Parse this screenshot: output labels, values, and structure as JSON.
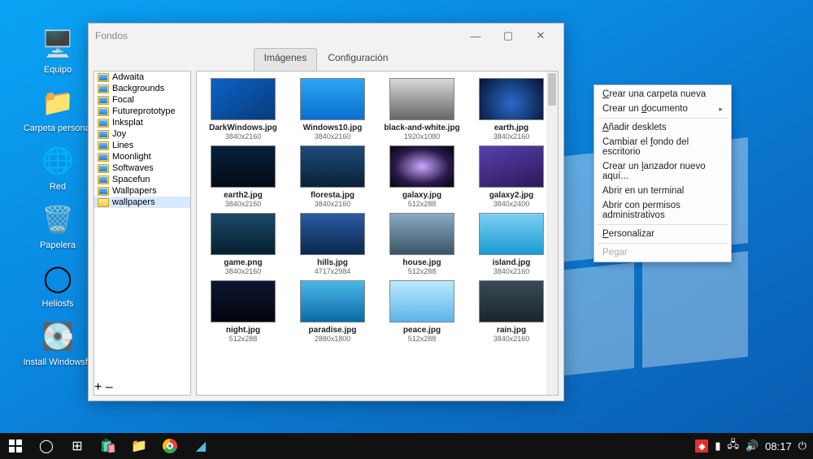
{
  "desktop_icons": [
    {
      "label": "Equipo",
      "glyph": "🖥️"
    },
    {
      "label": "Carpeta personal",
      "glyph": "📁"
    },
    {
      "label": "Red",
      "glyph": "🌐"
    },
    {
      "label": "Papelera",
      "glyph": "🗑️"
    },
    {
      "label": "Heliosfs",
      "glyph": "◯"
    },
    {
      "label": "Install Windowsfs",
      "glyph": "💽"
    }
  ],
  "window": {
    "title": "Fondos",
    "tabs": [
      {
        "label": "Imágenes",
        "active": true
      },
      {
        "label": "Configuración",
        "active": false
      }
    ],
    "folders": [
      {
        "name": "Adwaita",
        "type": "pic"
      },
      {
        "name": "Backgrounds",
        "type": "pic"
      },
      {
        "name": "Focal",
        "type": "pic"
      },
      {
        "name": "Futureprototype",
        "type": "pic"
      },
      {
        "name": "Inksplat",
        "type": "pic"
      },
      {
        "name": "Joy",
        "type": "pic"
      },
      {
        "name": "Lines",
        "type": "pic"
      },
      {
        "name": "Moonlight",
        "type": "pic"
      },
      {
        "name": "Softwaves",
        "type": "pic"
      },
      {
        "name": "Spacefun",
        "type": "pic"
      },
      {
        "name": "Wallpapers",
        "type": "pic"
      },
      {
        "name": "wallpapers",
        "type": "folder",
        "selected": true
      }
    ],
    "add_btn": "+",
    "del_btn": "–",
    "thumbs": [
      {
        "file": "DarkWindows.jpg",
        "dim": "3840x2160",
        "css": "linear-gradient(145deg,#0a63c7,#0a3a7a)"
      },
      {
        "file": "Windows10.jpg",
        "dim": "3840x2160",
        "css": "linear-gradient(180deg,#2aa6f2,#0a6fd0)"
      },
      {
        "file": "black-and-white.jpg",
        "dim": "1920x1080",
        "css": "linear-gradient(180deg,#d8d8d8,#666)"
      },
      {
        "file": "earth.jpg",
        "dim": "3840x2160",
        "css": "radial-gradient(circle at 50% 60%,#2a6bc9,#061230)"
      },
      {
        "file": "earth2.jpg",
        "dim": "3840x2160",
        "css": "linear-gradient(180deg,#08223d,#030a15)"
      },
      {
        "file": "floresta.jpg",
        "dim": "3840x2160",
        "css": "linear-gradient(180deg,#1d4a7a,#0a2238)"
      },
      {
        "file": "galaxy.jpg",
        "dim": "512x288",
        "css": "radial-gradient(ellipse at 50% 50%,#c9a8ff,#2a1a4a 60%,#05030c)"
      },
      {
        "file": "galaxy2.jpg",
        "dim": "3840x2400",
        "css": "linear-gradient(160deg,#5a3fae,#2a1a58)"
      },
      {
        "file": "game.png",
        "dim": "3840x2160",
        "css": "linear-gradient(180deg,#1a4a6a,#06202e)"
      },
      {
        "file": "hills.jpg",
        "dim": "4717x2984",
        "css": "linear-gradient(180deg,#2a5aa3,#0a2a4d)"
      },
      {
        "file": "house.jpg",
        "dim": "512x288",
        "css": "linear-gradient(180deg,#8aa9c4,#3a5568)"
      },
      {
        "file": "island.jpg",
        "dim": "3840x2160",
        "css": "linear-gradient(180deg,#7ed0f2,#1a9bd4)"
      },
      {
        "file": "night.jpg",
        "dim": "512x288",
        "css": "linear-gradient(180deg,#0c1630,#020510)"
      },
      {
        "file": "paradise.jpg",
        "dim": "2880x1800",
        "css": "linear-gradient(180deg,#4ab8e6,#0a6aa8)"
      },
      {
        "file": "peace.jpg",
        "dim": "512x288",
        "css": "linear-gradient(180deg,#bde8ff,#5ab5e8)"
      },
      {
        "file": "rain.jpg",
        "dim": "3840x2160",
        "css": "linear-gradient(180deg,#3a4a56,#1a262e)"
      }
    ]
  },
  "context_menu": [
    {
      "label": "Crear una carpeta nueva",
      "accel": "c"
    },
    {
      "label": "Crear un documento",
      "accel": "d",
      "submenu": true
    },
    {
      "sep": true
    },
    {
      "label": "Añadir desklets",
      "accel": "A"
    },
    {
      "label": "Cambiar el fondo del escritorio",
      "accel": "f"
    },
    {
      "label": "Crear un lanzador nuevo aquí...",
      "accel": "l"
    },
    {
      "label": "Abrir en un terminal"
    },
    {
      "label": "Abrir con permisos administrativos"
    },
    {
      "sep": true
    },
    {
      "label": "Personalizar",
      "accel": "P"
    },
    {
      "sep": true
    },
    {
      "label": "Pegar",
      "disabled": true
    }
  ],
  "taskbar": {
    "time": "08:17"
  }
}
